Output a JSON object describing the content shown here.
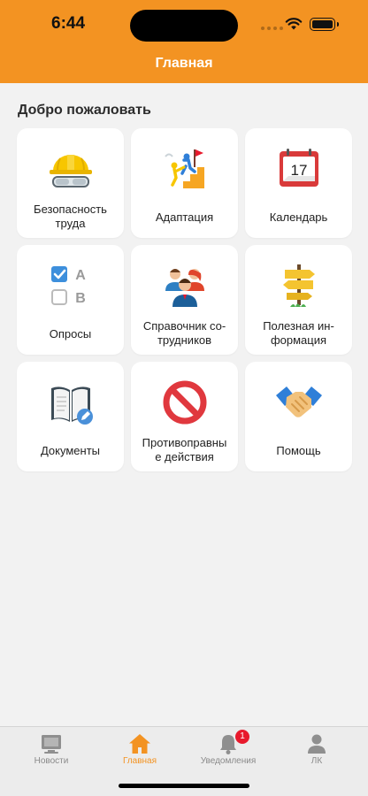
{
  "status": {
    "time": "6:44"
  },
  "header": {
    "title": "Главная"
  },
  "main": {
    "welcome": "Добро пожаловать",
    "tiles": [
      {
        "label": "Безопасность\nтруда",
        "icon": "hard-hat-goggles-icon"
      },
      {
        "label": "Адаптация",
        "icon": "climbing-steps-icon"
      },
      {
        "label": "Календарь",
        "icon": "calendar-icon",
        "day": "17"
      },
      {
        "label": "Опросы",
        "icon": "survey-checkbox-icon",
        "option_a": "A",
        "option_b": "B"
      },
      {
        "label": "Справочник со-\nтрудников",
        "icon": "employees-icon"
      },
      {
        "label": "Полезная ин-\nформация",
        "icon": "signpost-icon"
      },
      {
        "label": "Документы",
        "icon": "document-edit-icon"
      },
      {
        "label": "Противоправны\nе действия",
        "icon": "prohibited-icon"
      },
      {
        "label": "Помощь",
        "icon": "handshake-icon"
      }
    ]
  },
  "tabbar": {
    "items": [
      {
        "label": "Новости",
        "icon": "news-icon"
      },
      {
        "label": "Главная",
        "icon": "home-icon",
        "active": true
      },
      {
        "label": "Уведомления",
        "icon": "bell-icon",
        "badge": "1"
      },
      {
        "label": "ЛК",
        "icon": "profile-icon"
      }
    ]
  },
  "colors": {
    "accent": "#f39322",
    "badge": "#e8192c",
    "background": "#f2f2f2"
  }
}
